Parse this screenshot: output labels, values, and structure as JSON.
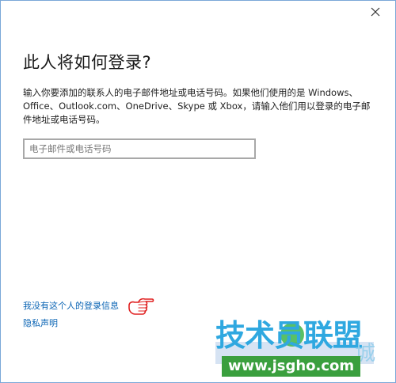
{
  "dialog": {
    "close_glyph": "✕",
    "title": "此人将如何登录?",
    "description": "输入你要添加的联系人的电子邮件地址或电话号码。如果他们使用的是 Windows、Office、Outlook.com、OneDrive、Skype 或 Xbox，请输入他们用以登录的电子邮件地址或电话号码。",
    "email_input": {
      "value": "",
      "placeholder": "电子邮件或电话号码"
    },
    "no_signin_info_link": "我没有这个人的登录信息",
    "privacy_link": "隐私声明"
  },
  "watermark": {
    "main_text": "技术员联盟",
    "url_text": "www.jsgho.com",
    "suffix_char": "城"
  },
  "icons": {
    "close": "close-icon",
    "pointer": "pointing-hand-icon"
  },
  "colors": {
    "dialog_border": "#7aa7d8",
    "link": "#0a64b4",
    "title_text": "#1a1a1a",
    "input_border": "#a8a8a8",
    "hand_outline": "#e02020",
    "watermark_blue": "#2fa8e0",
    "watermark_green": "#3a9f3e"
  }
}
